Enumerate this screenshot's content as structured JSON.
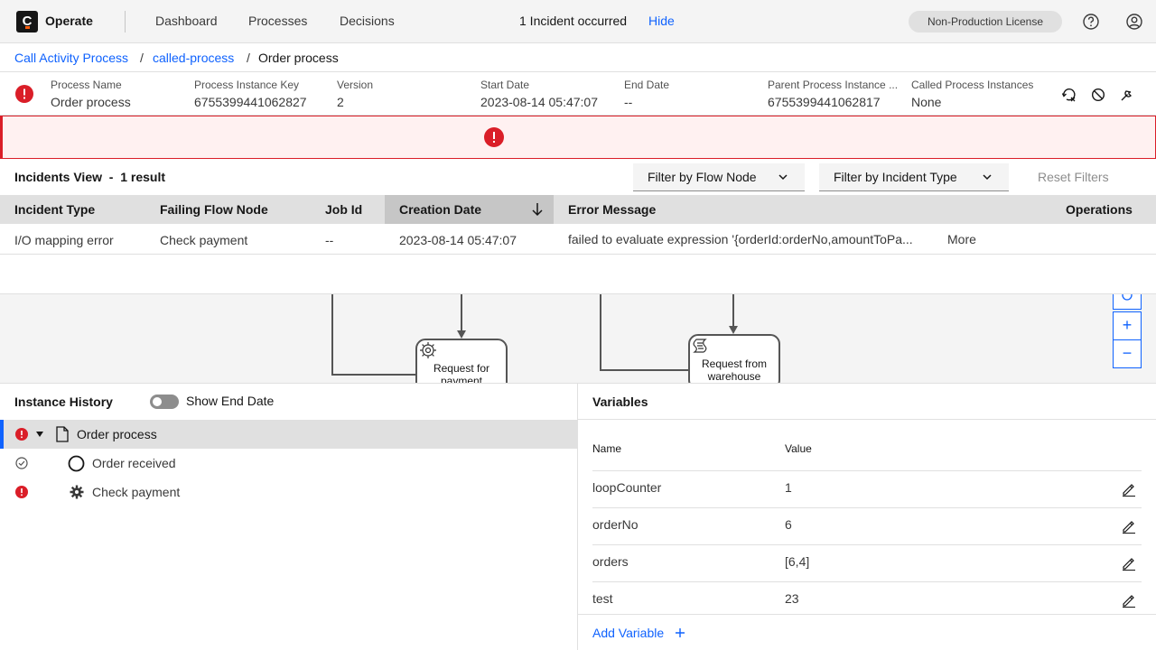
{
  "app": {
    "logo_letter": "C",
    "name": "Operate"
  },
  "nav": {
    "links": [
      "Dashboard",
      "Processes",
      "Decisions"
    ],
    "license": "Non-Production License"
  },
  "breadcrumb": {
    "items": [
      "Call Activity Process",
      "called-process",
      "Order process"
    ],
    "separator": "/"
  },
  "instance": {
    "fields": [
      {
        "label": "Process Name",
        "value": "Order process"
      },
      {
        "label": "Process Instance Key",
        "value": "6755399441062827"
      },
      {
        "label": "Version",
        "value": "2"
      },
      {
        "label": "Start Date",
        "value": "2023-08-14 05:47:07"
      },
      {
        "label": "End Date",
        "value": "--"
      },
      {
        "label": "Parent Process Instance ...",
        "value": "6755399441062817"
      },
      {
        "label": "Called Process Instances",
        "value": "None"
      }
    ]
  },
  "banner": {
    "text": "1 Incident occurred",
    "hide": "Hide"
  },
  "incidents": {
    "title": "Incidents View  -  1 result",
    "filter_flow_node": "Filter by Flow Node",
    "filter_incident_type": "Filter by Incident Type",
    "reset": "Reset Filters",
    "columns": [
      "Incident Type",
      "Failing Flow Node",
      "Job Id",
      "Creation Date",
      "Error Message",
      "Operations"
    ],
    "row": {
      "type": "I/O mapping error",
      "node": "Check payment",
      "job": "--",
      "date": "2023-08-14 05:47:07",
      "error": "failed to evaluate expression '{orderId:orderNo,amountToPa...",
      "more": "More"
    }
  },
  "diagram": {
    "task1_line1": "Request for",
    "task1_line2": "payment",
    "task2_line1": "Request from",
    "task2_line2": "warehouse",
    "zoom_in": "+",
    "zoom_out": "−"
  },
  "history": {
    "title": "Instance History",
    "toggle_label": "Show End Date",
    "items": [
      "Order process",
      "Order received",
      "Check payment"
    ]
  },
  "variables": {
    "title": "Variables",
    "col_name": "Name",
    "col_value": "Value",
    "rows": [
      {
        "name": "loopCounter",
        "value": "1"
      },
      {
        "name": "orderNo",
        "value": "6"
      },
      {
        "name": "orders",
        "value": "[6,4]"
      },
      {
        "name": "test",
        "value": "23"
      }
    ],
    "add": "Add Variable"
  },
  "colors": {
    "accent": "#0f62fe",
    "error": "#da1e28",
    "brand": "#fc5d0d"
  }
}
